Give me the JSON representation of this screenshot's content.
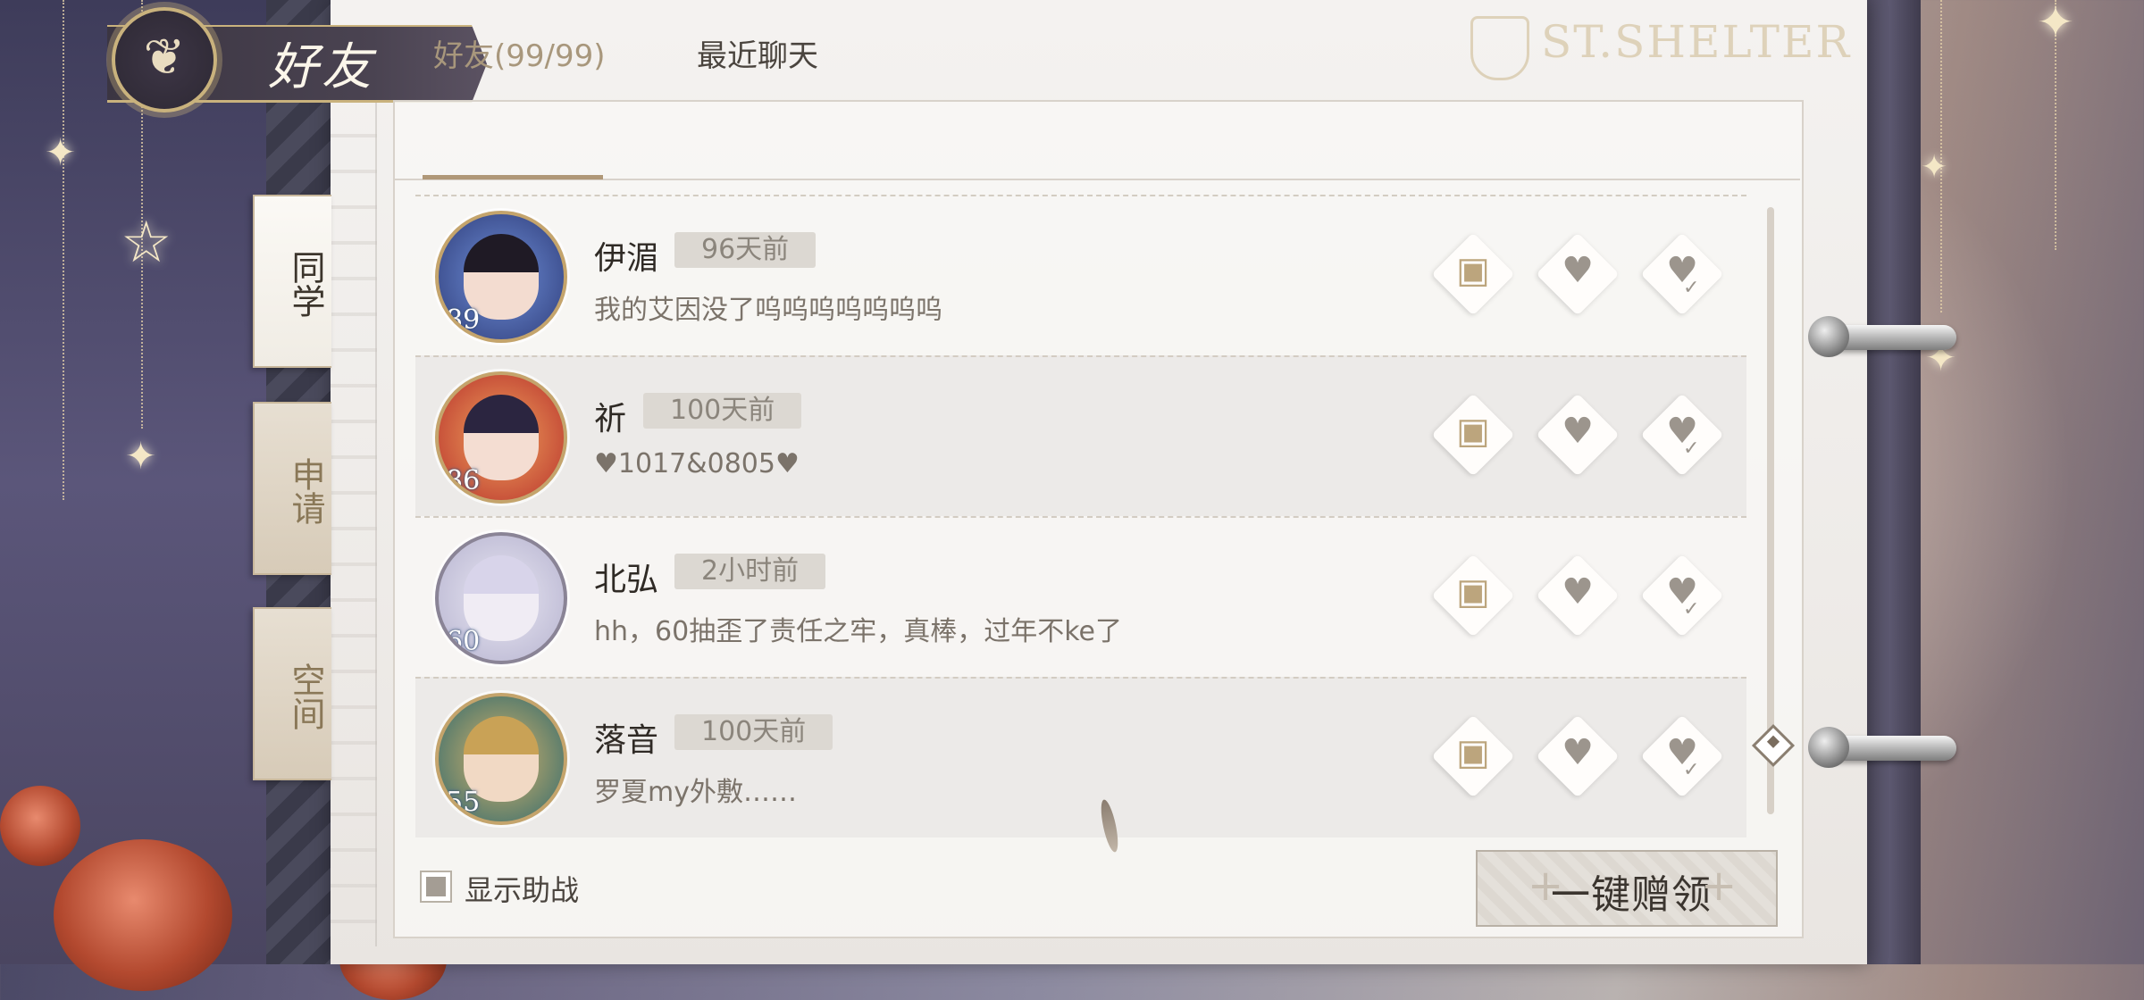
{
  "header": {
    "title": "好友",
    "icon": "butterfly-icon"
  },
  "watermark": "ST.SHELTER",
  "side_tabs": [
    {
      "label": "同学",
      "active": true
    },
    {
      "label": "申请",
      "active": false
    },
    {
      "label": "空间",
      "active": false
    }
  ],
  "top_tabs": [
    {
      "label": "好友(99/99)",
      "active": true
    },
    {
      "label": "最近聊天",
      "active": false
    }
  ],
  "friends": [
    {
      "name": "伊湄",
      "time": "96天前",
      "status": "我的艾因没了呜呜呜呜呜呜呜",
      "level": "89",
      "avatar_colors": [
        "#2f3d7a",
        "#6f8fd8"
      ]
    },
    {
      "name": "祈",
      "time": "100天前",
      "status": "♥1017&0805♥",
      "level": "86",
      "avatar_colors": [
        "#b8322c",
        "#f0a35d"
      ]
    },
    {
      "name": "北弘",
      "time": "2小时前",
      "status": "hh，60抽歪了责任之牢，真棒，过年不ke了",
      "level": "60",
      "avatar_colors": [
        "#b6b3cf",
        "#e9e7f3"
      ]
    },
    {
      "name": "落音",
      "time": "100天前",
      "status": "罗夏my外敷……",
      "level": "55",
      "avatar_colors": [
        "#2f6a6e",
        "#d8b46a"
      ]
    }
  ],
  "row_actions": [
    "chat-icon",
    "send-heart-icon",
    "receive-heart-icon"
  ],
  "footer": {
    "show_assist_label": "显示助战",
    "show_assist_checked": true,
    "claim_all_label": "一键赠领"
  },
  "colors": {
    "accent_gold": "#c9b27d",
    "tab_active": "#a8977c",
    "page_bg": "#f4f2f0"
  }
}
